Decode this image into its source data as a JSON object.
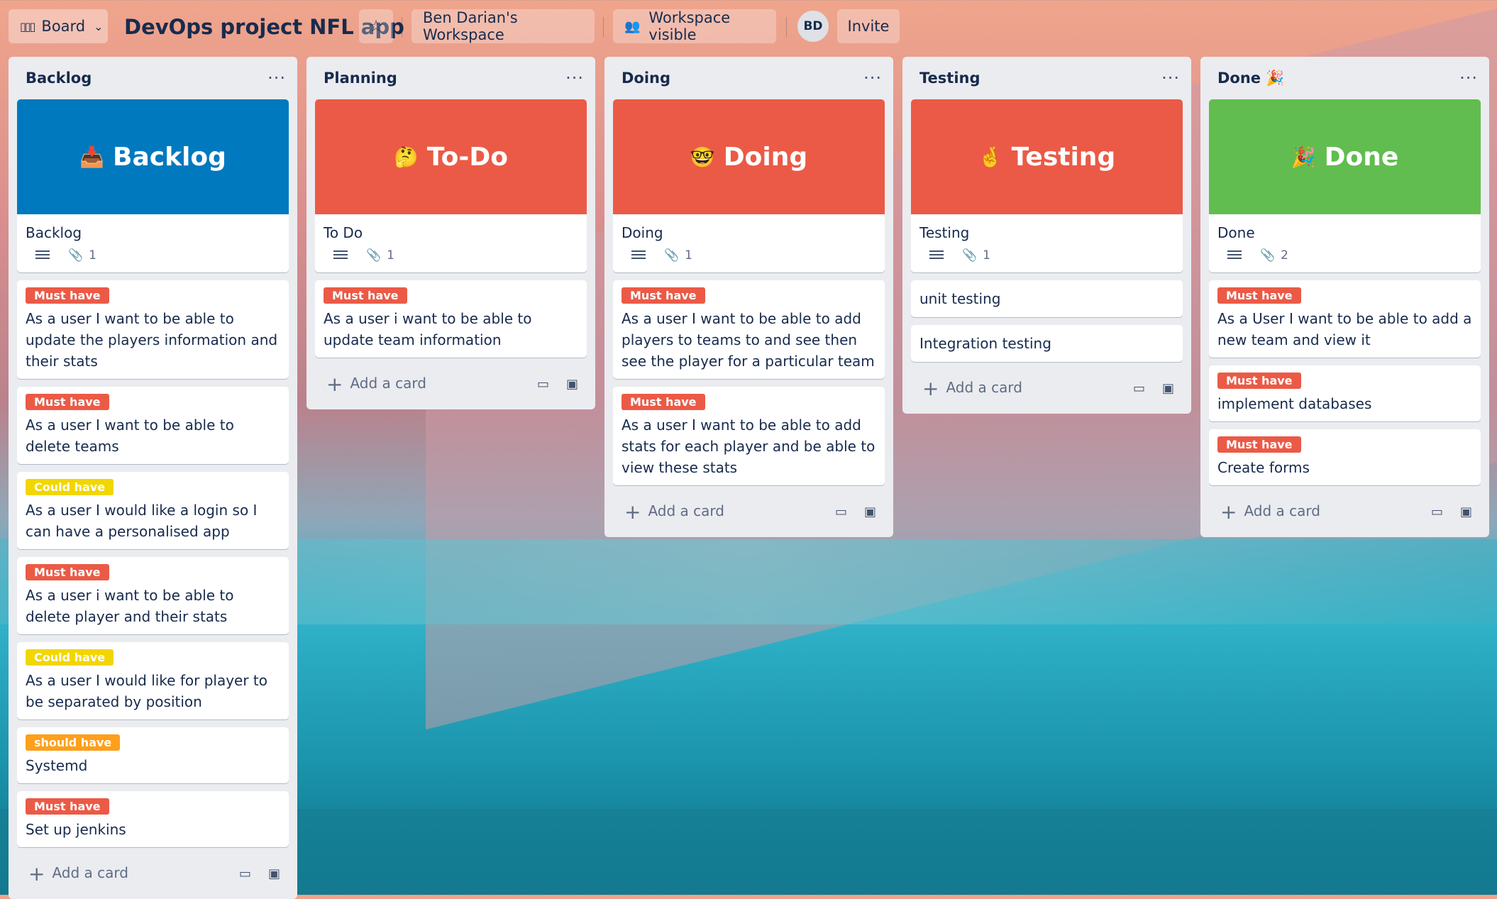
{
  "header": {
    "board_label": "Board",
    "title": "DevOps project NFL app",
    "workspace": "Ben Darian's Workspace",
    "visibility": "Workspace visible",
    "avatar_initials": "BD",
    "invite": "Invite"
  },
  "label_colors": {
    "must": "#eb5a46",
    "could": "#f2d600",
    "should": "#ff9f1a"
  },
  "lists": [
    {
      "title": "Backlog",
      "cover": {
        "emoji": "📥",
        "text": "Backlog",
        "color": "#0079bf"
      },
      "cover_card_title": "Backlog",
      "attachments": "1",
      "cards": [
        {
          "label": "Must have",
          "text": "As a user I want to be able to update the players information and their stats"
        },
        {
          "label": "Must have",
          "text": "As a user I want to be able to delete teams"
        },
        {
          "label": "Could have",
          "text": "As a user I would like a login so I can have a personalised app"
        },
        {
          "label": "Must have",
          "text": "As a user i want to be able to delete player and their stats"
        },
        {
          "label": "Could have",
          "text": "As a user I would like for player to be separated by position"
        },
        {
          "label": "should have",
          "text": "Systemd"
        },
        {
          "label": "Must have",
          "text": "Set up jenkins"
        }
      ],
      "add_card": "Add a card"
    },
    {
      "title": "Planning",
      "cover": {
        "emoji": "🤔",
        "text": "To-Do",
        "color": "#eb5a46"
      },
      "cover_card_title": "To Do",
      "attachments": "1",
      "cards": [
        {
          "label": "Must have",
          "text": "As a user i want to be able to update team information"
        }
      ],
      "add_card": "Add a card"
    },
    {
      "title": "Doing",
      "cover": {
        "emoji": "🤓",
        "text": "Doing",
        "color": "#eb5a46"
      },
      "cover_card_title": "Doing",
      "attachments": "1",
      "cards": [
        {
          "label": "Must have",
          "text": "As a user I want to be able to add players to teams to and see then see the player for a particular team"
        },
        {
          "label": "Must have",
          "text": "As a user I want to be able to add stats for each player and be able to view these stats"
        }
      ],
      "add_card": "Add a card"
    },
    {
      "title": "Testing",
      "cover": {
        "emoji": "🤞",
        "text": "Testing",
        "color": "#eb5a46"
      },
      "cover_card_title": "Testing",
      "attachments": "1",
      "simple_cards": [
        "unit testing",
        "Integration testing"
      ],
      "add_card": "Add a card"
    },
    {
      "title": "Done 🎉",
      "cover": {
        "emoji": "🎉",
        "text": "Done",
        "color": "#61bd4f"
      },
      "cover_card_title": "Done",
      "attachments": "2",
      "cards": [
        {
          "label": "Must have",
          "text": "As a User I want to be able to add a new team and view it"
        },
        {
          "label": "Must have",
          "text": "implement databases"
        },
        {
          "label": "Must have",
          "text": "Create forms"
        }
      ],
      "add_card": "Add a card"
    }
  ]
}
